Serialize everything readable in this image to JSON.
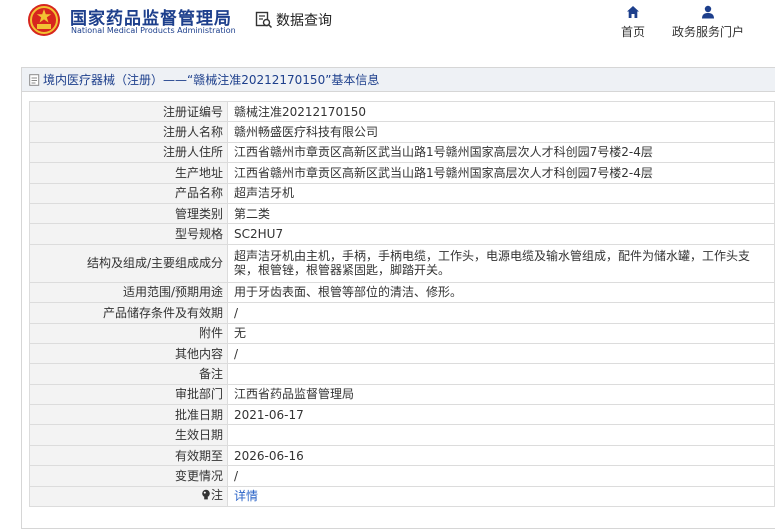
{
  "header": {
    "org_name_cn": "国家药品监督管理局",
    "org_name_en": "National Medical Products Administration",
    "query_label": "数据查询",
    "nav": [
      {
        "label": "首页",
        "icon": "home-icon"
      },
      {
        "label": "政务服务门户",
        "icon": "user-icon"
      }
    ]
  },
  "panel": {
    "title": "境内医疗器械（注册）——“赣械注准20212170150”基本信息"
  },
  "rows": [
    {
      "key": "注册证编号",
      "value": "赣械注准20212170150"
    },
    {
      "key": "注册人名称",
      "value": "赣州畅盛医疗科技有限公司"
    },
    {
      "key": "注册人住所",
      "value": "江西省赣州市章贡区高新区武当山路1号赣州国家高层次人才科创园7号楼2-4层"
    },
    {
      "key": "生产地址",
      "value": "江西省赣州市章贡区高新区武当山路1号赣州国家高层次人才科创园7号楼2-4层"
    },
    {
      "key": "产品名称",
      "value": "超声洁牙机"
    },
    {
      "key": "管理类别",
      "value": "第二类"
    },
    {
      "key": "型号规格",
      "value": "SC2HU7"
    },
    {
      "key": "结构及组成/主要组成成分",
      "value": "超声洁牙机由主机，手柄，手柄电缆，工作头，电源电缆及输水管组成，配件为储水罐，工作头支架，根管锉，根管器紧固匙，脚踏开关。"
    },
    {
      "key": "适用范围/预期用途",
      "value": "用于牙齿表面、根管等部位的清洁、修形。"
    },
    {
      "key": "产品储存条件及有效期",
      "value": "/"
    },
    {
      "key": "附件",
      "value": "无"
    },
    {
      "key": "其他内容",
      "value": "/"
    },
    {
      "key": "备注",
      "value": ""
    },
    {
      "key": "审批部门",
      "value": "江西省药品监督管理局"
    },
    {
      "key": "批准日期",
      "value": "2021-06-17"
    },
    {
      "key": "生效日期",
      "value": ""
    },
    {
      "key": "有效期至",
      "value": "2026-06-16"
    },
    {
      "key": "变更情况",
      "value": "/"
    }
  ],
  "note": {
    "key": "注",
    "link": "详情",
    "icon": "lightbulb-icon"
  }
}
